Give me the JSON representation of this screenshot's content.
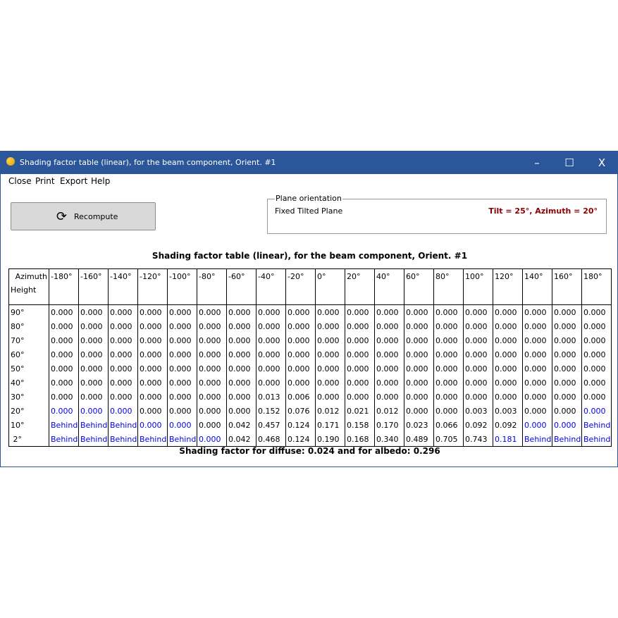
{
  "window": {
    "title": "Shading factor table (linear), for the beam component, Orient. #1",
    "minimize": "–",
    "maximize": "☐",
    "close": "X"
  },
  "menu": [
    "Close",
    "Print",
    "Export",
    "Help"
  ],
  "recompute": {
    "label": "Recompute",
    "icon": "refresh-icon"
  },
  "plane": {
    "legend": "Plane orientation",
    "type": "Fixed Tilted Plane",
    "params": "Tilt = 25°, Azimuth = 20°"
  },
  "caption": "Shading factor table (linear), for the beam component, Orient. #1",
  "table": {
    "azimuth_label": "Azimuth",
    "height_label": "Height",
    "columns": [
      "-180°",
      "-160°",
      "-140°",
      "-120°",
      "-100°",
      "-80°",
      "-60°",
      "-40°",
      "-20°",
      "0°",
      "20°",
      "40°",
      "60°",
      "80°",
      "100°",
      "120°",
      "140°",
      "160°",
      "180°"
    ],
    "rows": [
      {
        "h": "90°",
        "v": [
          "0.000",
          "0.000",
          "0.000",
          "0.000",
          "0.000",
          "0.000",
          "0.000",
          "0.000",
          "0.000",
          "0.000",
          "0.000",
          "0.000",
          "0.000",
          "0.000",
          "0.000",
          "0.000",
          "0.000",
          "0.000",
          "0.000"
        ],
        "blue": []
      },
      {
        "h": "80°",
        "v": [
          "0.000",
          "0.000",
          "0.000",
          "0.000",
          "0.000",
          "0.000",
          "0.000",
          "0.000",
          "0.000",
          "0.000",
          "0.000",
          "0.000",
          "0.000",
          "0.000",
          "0.000",
          "0.000",
          "0.000",
          "0.000",
          "0.000"
        ],
        "blue": []
      },
      {
        "h": "70°",
        "v": [
          "0.000",
          "0.000",
          "0.000",
          "0.000",
          "0.000",
          "0.000",
          "0.000",
          "0.000",
          "0.000",
          "0.000",
          "0.000",
          "0.000",
          "0.000",
          "0.000",
          "0.000",
          "0.000",
          "0.000",
          "0.000",
          "0.000"
        ],
        "blue": []
      },
      {
        "h": "60°",
        "v": [
          "0.000",
          "0.000",
          "0.000",
          "0.000",
          "0.000",
          "0.000",
          "0.000",
          "0.000",
          "0.000",
          "0.000",
          "0.000",
          "0.000",
          "0.000",
          "0.000",
          "0.000",
          "0.000",
          "0.000",
          "0.000",
          "0.000"
        ],
        "blue": []
      },
      {
        "h": "50°",
        "v": [
          "0.000",
          "0.000",
          "0.000",
          "0.000",
          "0.000",
          "0.000",
          "0.000",
          "0.000",
          "0.000",
          "0.000",
          "0.000",
          "0.000",
          "0.000",
          "0.000",
          "0.000",
          "0.000",
          "0.000",
          "0.000",
          "0.000"
        ],
        "blue": []
      },
      {
        "h": "40°",
        "v": [
          "0.000",
          "0.000",
          "0.000",
          "0.000",
          "0.000",
          "0.000",
          "0.000",
          "0.000",
          "0.000",
          "0.000",
          "0.000",
          "0.000",
          "0.000",
          "0.000",
          "0.000",
          "0.000",
          "0.000",
          "0.000",
          "0.000"
        ],
        "blue": []
      },
      {
        "h": "30°",
        "v": [
          "0.000",
          "0.000",
          "0.000",
          "0.000",
          "0.000",
          "0.000",
          "0.000",
          "0.013",
          "0.006",
          "0.000",
          "0.000",
          "0.000",
          "0.000",
          "0.000",
          "0.000",
          "0.000",
          "0.000",
          "0.000",
          "0.000"
        ],
        "blue": []
      },
      {
        "h": "20°",
        "v": [
          "0.000",
          "0.000",
          "0.000",
          "0.000",
          "0.000",
          "0.000",
          "0.000",
          "0.152",
          "0.076",
          "0.012",
          "0.021",
          "0.012",
          "0.000",
          "0.000",
          "0.003",
          "0.003",
          "0.000",
          "0.000",
          "0.000"
        ],
        "blue": [
          0,
          1,
          2,
          18
        ]
      },
      {
        "h": "10°",
        "v": [
          "Behind",
          "Behind",
          "Behind",
          "0.000",
          "0.000",
          "0.000",
          "0.042",
          "0.457",
          "0.124",
          "0.171",
          "0.158",
          "0.170",
          "0.023",
          "0.066",
          "0.092",
          "0.092",
          "0.000",
          "0.000",
          "Behind"
        ],
        "blue": [
          0,
          1,
          2,
          3,
          4,
          16,
          17,
          18
        ]
      },
      {
        "h": " 2°",
        "v": [
          "Behind",
          "Behind",
          "Behind",
          "Behind",
          "Behind",
          "0.000",
          "0.042",
          "0.468",
          "0.124",
          "0.190",
          "0.168",
          "0.340",
          "0.489",
          "0.705",
          "0.743",
          "0.181",
          "Behind",
          "Behind",
          "Behind"
        ],
        "blue": [
          0,
          1,
          2,
          3,
          4,
          5,
          15,
          16,
          17,
          18
        ]
      }
    ]
  },
  "footer": "Shading factor for diffuse:  0.024  and for albedo:  0.296"
}
